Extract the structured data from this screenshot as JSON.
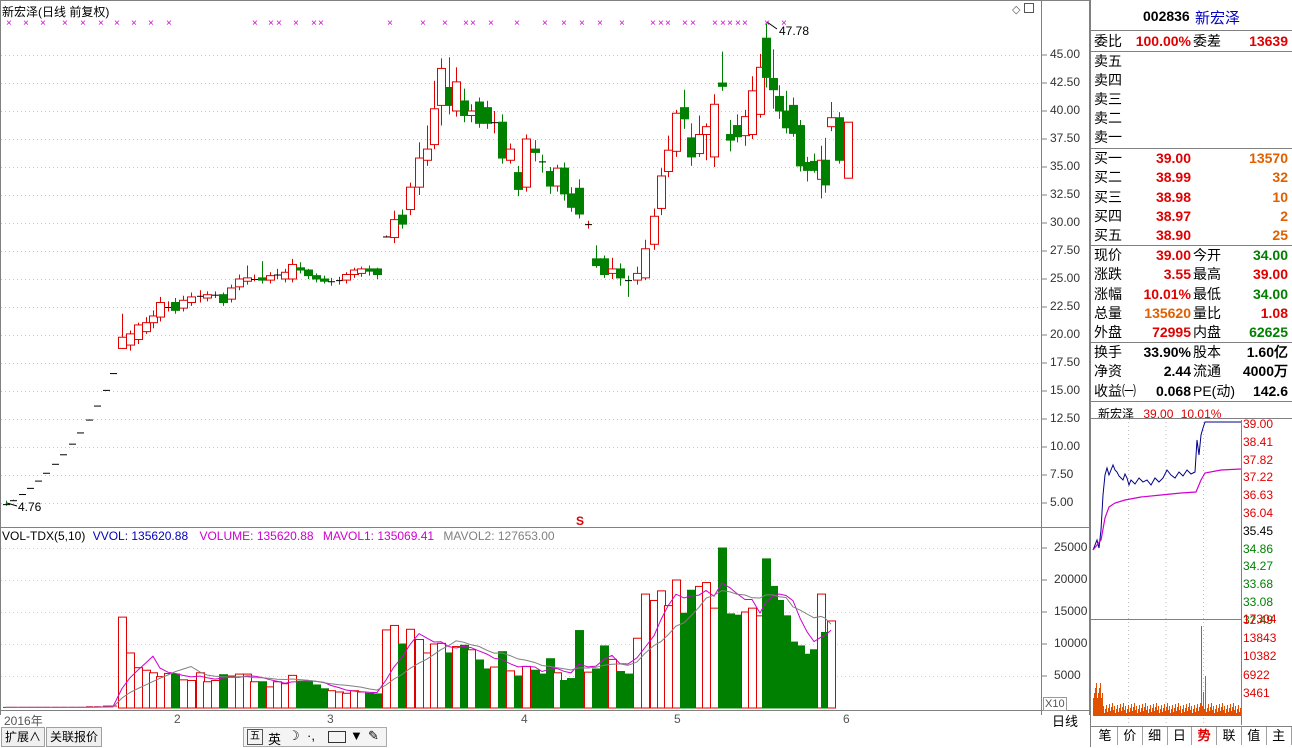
{
  "stock": {
    "code": "002836",
    "name": "新宏泽"
  },
  "chart_title": "新宏泽(日线 前复权)",
  "colors": {
    "up": "#e00000",
    "down": "#008000",
    "ma1": "#d000d0",
    "ma2": "#808080",
    "grid": "#a0a0a0"
  },
  "main_chart": {
    "high_label": "47.78",
    "low_label": "4.76",
    "signal_mark": "S",
    "price_ticks": [
      "45.00",
      "42.50",
      "40.00",
      "37.50",
      "35.00",
      "32.50",
      "30.00",
      "27.50",
      "25.00",
      "22.50",
      "20.00",
      "17.50",
      "15.00",
      "12.50",
      "10.00",
      "7.50",
      "5.00"
    ]
  },
  "vol_panel": {
    "title": "VOL-TDX(5,10)",
    "vvol_label": "VVOL: 135620.88",
    "volume_label": "VOLUME: 135620.88",
    "mavol1_label": "MAVOL1: 135069.41",
    "mavol2_label": "MAVOL2: 127653.00",
    "ticks": [
      "25000",
      "20000",
      "15000",
      "10000",
      "5000"
    ],
    "unit": "X10"
  },
  "time_axis": {
    "labels": [
      "2016年",
      "2",
      "3",
      "4",
      "5",
      "6"
    ],
    "period": "日线"
  },
  "bottom_tabs": [
    "扩展∧",
    "关联报价"
  ],
  "toolbar_icons": [
    "grid-icon",
    "eng-ime-icon",
    "moon-icon",
    "dots-icon",
    "keyboard-icon",
    "shirt-icon",
    "wrench-icon"
  ],
  "toolbar_labels": {
    "ime": "英"
  },
  "quote": {
    "weibi_label": "委比",
    "weibi_value": "100.00%",
    "weicha_label": "委差",
    "weicha_value": "13639",
    "sell": [
      {
        "label": "卖五",
        "price": "",
        "vol": ""
      },
      {
        "label": "卖四",
        "price": "",
        "vol": ""
      },
      {
        "label": "卖三",
        "price": "",
        "vol": ""
      },
      {
        "label": "卖二",
        "price": "",
        "vol": ""
      },
      {
        "label": "卖一",
        "price": "",
        "vol": ""
      }
    ],
    "buy": [
      {
        "label": "买一",
        "price": "39.00",
        "vol": "13570"
      },
      {
        "label": "买二",
        "price": "38.99",
        "vol": "32"
      },
      {
        "label": "买三",
        "price": "38.98",
        "vol": "10"
      },
      {
        "label": "买四",
        "price": "38.97",
        "vol": "2"
      },
      {
        "label": "买五",
        "price": "38.90",
        "vol": "25"
      }
    ],
    "stats": [
      {
        "l1": "现价",
        "v1": "39.00",
        "c1": "red",
        "l2": "今开",
        "v2": "34.00",
        "c2": "green"
      },
      {
        "l1": "涨跌",
        "v1": "3.55",
        "c1": "red",
        "l2": "最高",
        "v2": "39.00",
        "c2": "red"
      },
      {
        "l1": "涨幅",
        "v1": "10.01%",
        "c1": "red",
        "l2": "最低",
        "v2": "34.00",
        "c2": "green"
      },
      {
        "l1": "总量",
        "v1": "135620",
        "c1": "orange",
        "l2": "量比",
        "v2": "1.08",
        "c2": "red"
      },
      {
        "l1": "外盘",
        "v1": "72995",
        "c1": "red",
        "l2": "内盘",
        "v2": "62625",
        "c2": "green"
      }
    ],
    "fund": [
      {
        "l1": "换手",
        "v1": "33.90%",
        "l2": "股本",
        "v2": "1.60亿"
      },
      {
        "l1": "净资",
        "v1": "2.44",
        "l2": "流通",
        "v2": "4000万"
      },
      {
        "l1": "收益㈠",
        "v1": "0.068",
        "l2": "PE(动)",
        "v2": "142.6"
      }
    ]
  },
  "mini_chart": {
    "name": "新宏泽",
    "price": "39.00",
    "pct": "10.01%",
    "price_ticks": [
      "39.00",
      "38.41",
      "37.82",
      "37.22",
      "36.63",
      "36.04",
      "35.45",
      "34.86",
      "34.27",
      "33.68",
      "33.08",
      "32.49"
    ],
    "vol_ticks": [
      "17304",
      "13843",
      "10382",
      "6922",
      "3461"
    ]
  },
  "right_tabs": [
    "笔",
    "价",
    "细",
    "日",
    "势",
    "联",
    "值",
    "主"
  ],
  "active_right_tab": "势"
}
